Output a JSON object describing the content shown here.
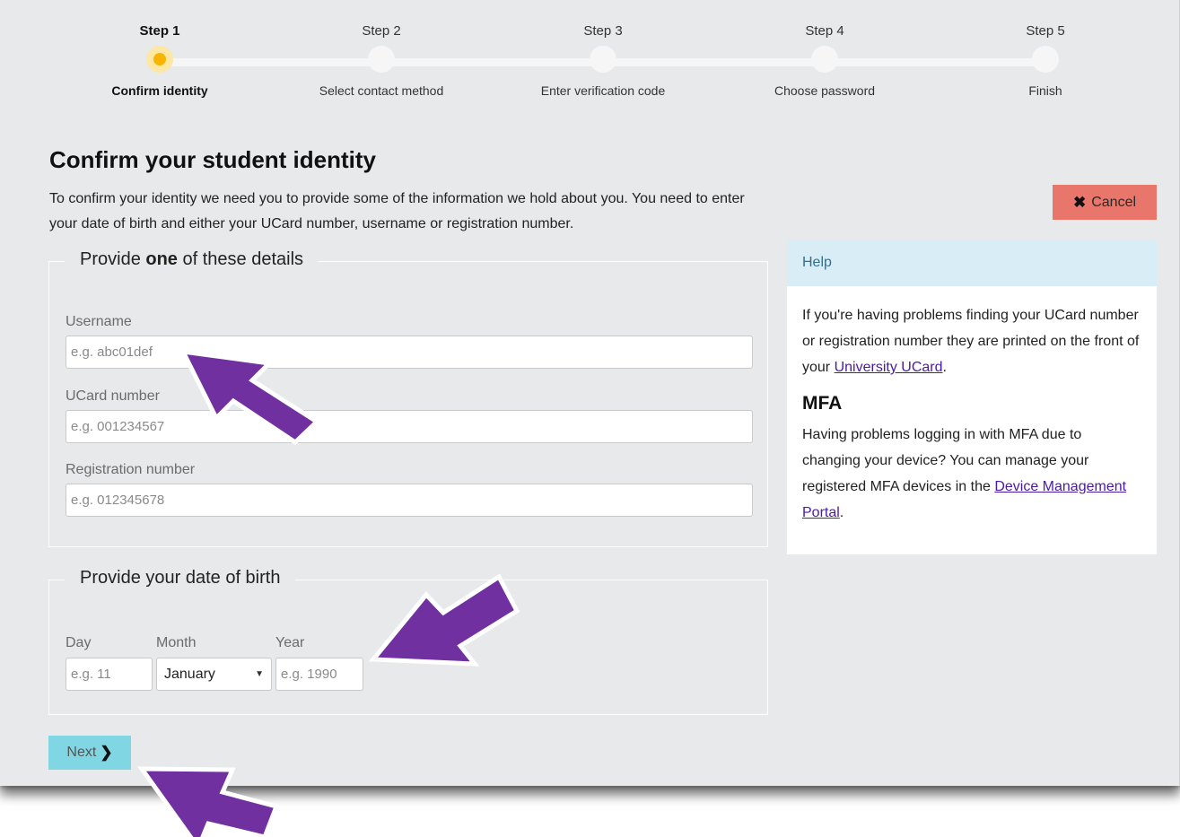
{
  "progress": {
    "steps": [
      {
        "title": "Step 1",
        "label": "Confirm identity",
        "active": true
      },
      {
        "title": "Step 2",
        "label": "Select contact method",
        "active": false
      },
      {
        "title": "Step 3",
        "label": "Enter verification code",
        "active": false
      },
      {
        "title": "Step 4",
        "label": "Choose password",
        "active": false
      },
      {
        "title": "Step 5",
        "label": "Finish",
        "active": false
      }
    ],
    "active_color": "#f7b500"
  },
  "page": {
    "title": "Confirm your student identity",
    "intro": "To confirm your identity we need you to provide some of the information we hold about you. You need to enter your date of birth and either your UCard number, username or registration number."
  },
  "cancel": {
    "icon": "times-icon",
    "label": "Cancel",
    "color": "#e8766b"
  },
  "details_group": {
    "legend_prefix": "Provide ",
    "legend_bold": "one",
    "legend_suffix": " of these details",
    "fields": {
      "username": {
        "label": "Username",
        "placeholder": "e.g. abc01def",
        "value": ""
      },
      "ucard": {
        "label": "UCard number",
        "placeholder": "e.g. 001234567",
        "value": ""
      },
      "registration": {
        "label": "Registration number",
        "placeholder": "e.g. 012345678",
        "value": ""
      }
    }
  },
  "dob_group": {
    "legend": "Provide your date of birth",
    "day": {
      "label": "Day",
      "placeholder": "e.g. 11",
      "value": ""
    },
    "month": {
      "label": "Month",
      "value": "January"
    },
    "year": {
      "label": "Year",
      "placeholder": "e.g. 1990",
      "value": ""
    }
  },
  "next": {
    "label": "Next",
    "icon": "chevron-right-icon",
    "color": "#80d6e3"
  },
  "help": {
    "header": "Help",
    "text_before": "If you're having problems finding your UCard number or registration number they are printed on the front of your ",
    "link": "University UCard",
    "text_after": ".",
    "mfa_heading": "MFA",
    "mfa_before": "Having problems logging in with MFA due to changing your device? You can manage your registered MFA devices in the ",
    "mfa_link": "Device Management Portal",
    "mfa_after": "."
  },
  "annotations": {
    "arrow_color": "#7030a0",
    "arrow_outline": "#ffffff"
  }
}
